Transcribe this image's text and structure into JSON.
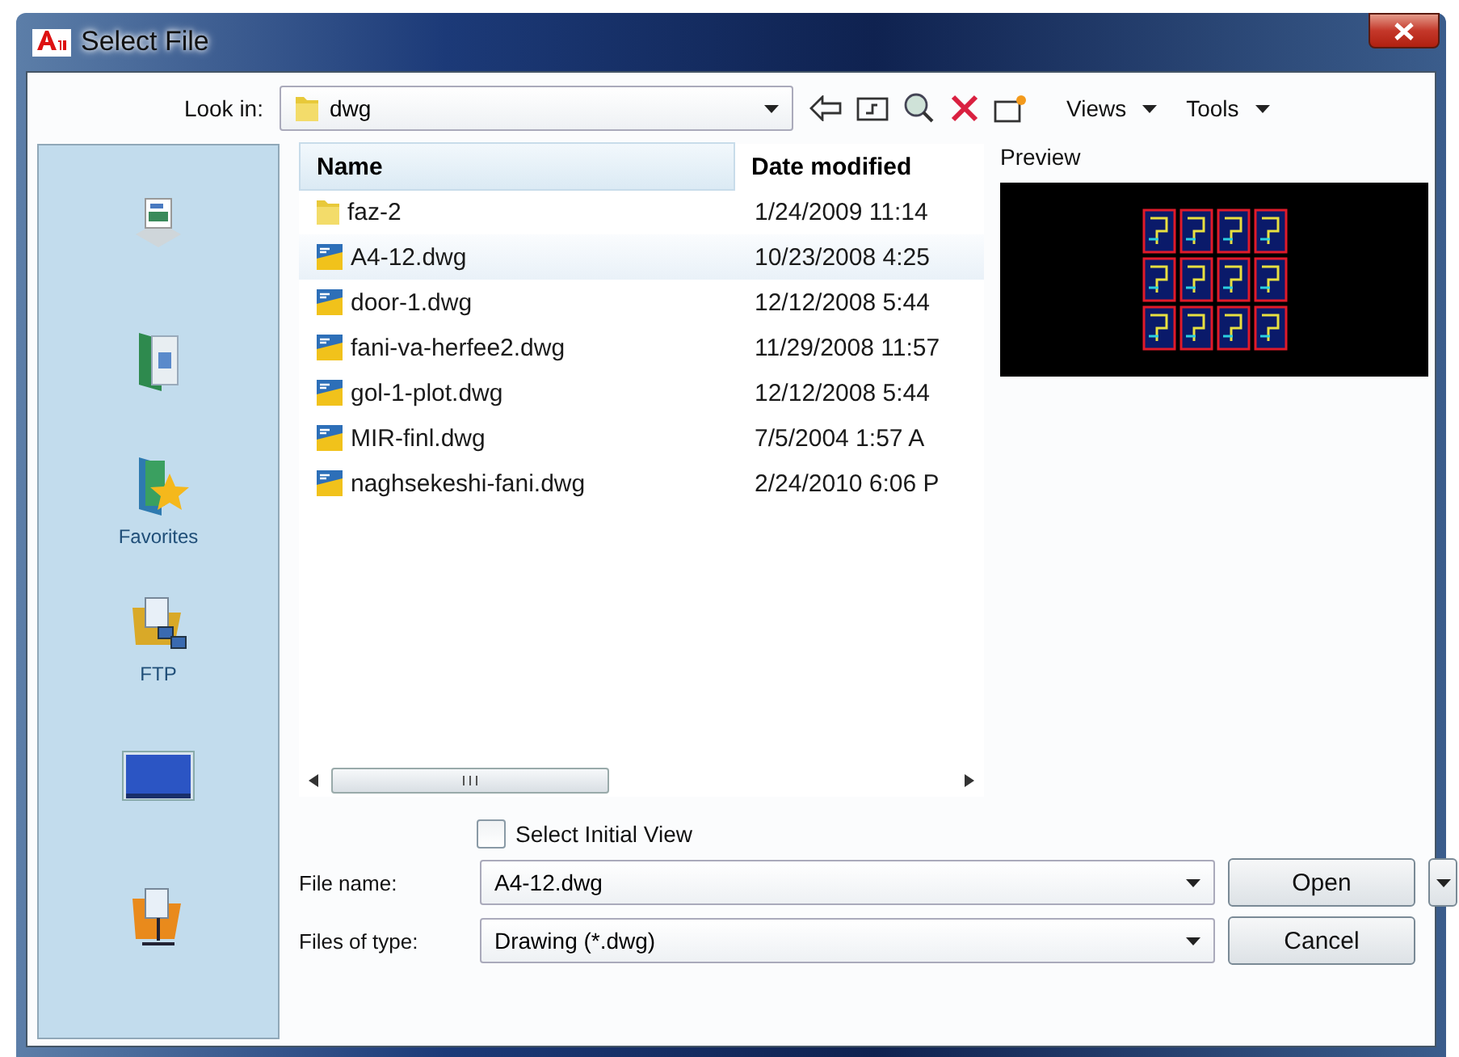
{
  "window": {
    "title": "Select File"
  },
  "look_in": {
    "label": "Look in:",
    "value": "dwg"
  },
  "toolbar": {
    "menus": [
      "Views",
      "Tools"
    ]
  },
  "sidebar": {
    "items": [
      {
        "kind": "history"
      },
      {
        "kind": "documents"
      },
      {
        "kind": "favorites",
        "label": "Favorites"
      },
      {
        "kind": "ftp",
        "label": "FTP"
      },
      {
        "kind": "desktop"
      },
      {
        "kind": "buzzsaw"
      }
    ]
  },
  "file_list": {
    "columns": [
      "Name",
      "Date modified"
    ],
    "rows": [
      {
        "kind": "folder",
        "name": "faz-2",
        "date": "1/24/2009 11:14",
        "selected": false
      },
      {
        "kind": "drawing",
        "name": "A4-12.dwg",
        "date": "10/23/2008 4:25",
        "selected": true
      },
      {
        "kind": "drawing",
        "name": "door-1.dwg",
        "date": "12/12/2008 5:44",
        "selected": false
      },
      {
        "kind": "drawing",
        "name": "fani-va-herfee2.dwg",
        "date": "11/29/2008 11:57",
        "selected": false
      },
      {
        "kind": "drawing",
        "name": "gol-1-plot.dwg",
        "date": "12/12/2008 5:44",
        "selected": false
      },
      {
        "kind": "drawing",
        "name": "MIR-finl.dwg",
        "date": "7/5/2004 1:57 A",
        "selected": false
      },
      {
        "kind": "drawing",
        "name": "naghsekeshi-fani.dwg",
        "date": "2/24/2010 6:06 P",
        "selected": false
      }
    ]
  },
  "preview": {
    "label": "Preview"
  },
  "select_initial_view": {
    "label": "Select Initial View",
    "checked": false
  },
  "file_name": {
    "label": "File name:",
    "value": "A4-12.dwg"
  },
  "file_type": {
    "label": "Files of type:",
    "value": "Drawing (*.dwg)"
  },
  "buttons": [
    "Open",
    "Cancel"
  ]
}
